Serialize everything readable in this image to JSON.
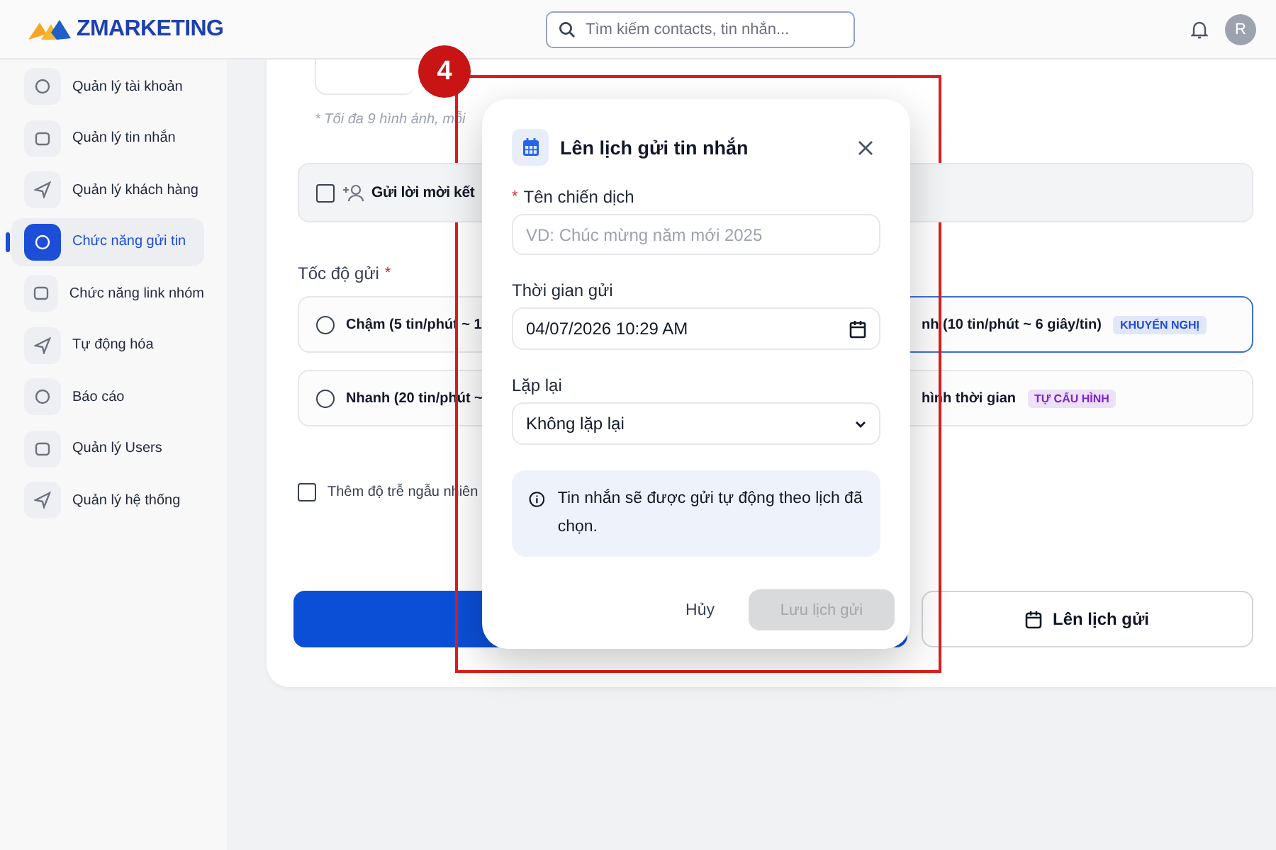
{
  "header": {
    "logo": "ZMARKETING",
    "search": {
      "placeholder": "Tìm kiếm contacts, tin nhắn..."
    },
    "avatar": "R"
  },
  "sidebar": {
    "items": [
      {
        "label": "Quản lý tài khoản",
        "selected": false
      },
      {
        "label": "Quản lý tin nhắn",
        "selected": false
      },
      {
        "label": "Quản lý khách hàng",
        "selected": false
      },
      {
        "label": "Chức năng gửi tin",
        "selected": true
      },
      {
        "label": "Chức năng link nhóm",
        "selected": false
      },
      {
        "label": "Tự động hóa",
        "selected": false
      },
      {
        "label": "Báo cáo",
        "selected": false
      },
      {
        "label": "Quản lý Users",
        "selected": false
      },
      {
        "label": "Quản lý hệ thống",
        "selected": false
      }
    ]
  },
  "form": {
    "image_note": "* Tối đa 9 hình ảnh, mỗi",
    "invite": {
      "label": "Gửi lời mời kết",
      "checked": false
    },
    "speed": {
      "label": "Tốc độ gửi",
      "required_mark": "*",
      "options": [
        {
          "label": "Chậm (5 tin/phút ~ 1",
          "selected": false
        },
        {
          "label": "nh (10 tin/phút ~ 6 giây/tin)",
          "selected": true,
          "badge": {
            "text": "KHUYẾN NGHỊ",
            "color": "#1d4ed8"
          }
        },
        {
          "label": "Nhanh (20 tin/phút ~",
          "selected": false
        },
        {
          "label": "hình thời gian",
          "selected": false,
          "badge": {
            "text": "TỰ CẤU HÌNH",
            "color": "#7e22ce"
          }
        }
      ]
    },
    "random_delay": {
      "label": "Thêm độ trễ ngẫu nhiên",
      "checked": false
    },
    "schedule_button": "Lên lịch gửi"
  },
  "modal": {
    "title": "Lên lịch gửi tin nhắn",
    "campaign": {
      "label": "Tên chiến dịch",
      "required_mark": "*",
      "placeholder": "VD: Chúc mừng năm mới 2025"
    },
    "send_time": {
      "label": "Thời gian gửi",
      "value": "04/07/2026 10:29 AM"
    },
    "repeat": {
      "label": "Lặp lại",
      "value": "Không lặp lại"
    },
    "info": "Tin nhắn sẽ được gửi tự động theo lịch đã chọn.",
    "cancel": "Hủy",
    "save": {
      "label": "Lưu lịch gửi",
      "disabled": true
    }
  },
  "annotation": {
    "step": "4"
  }
}
